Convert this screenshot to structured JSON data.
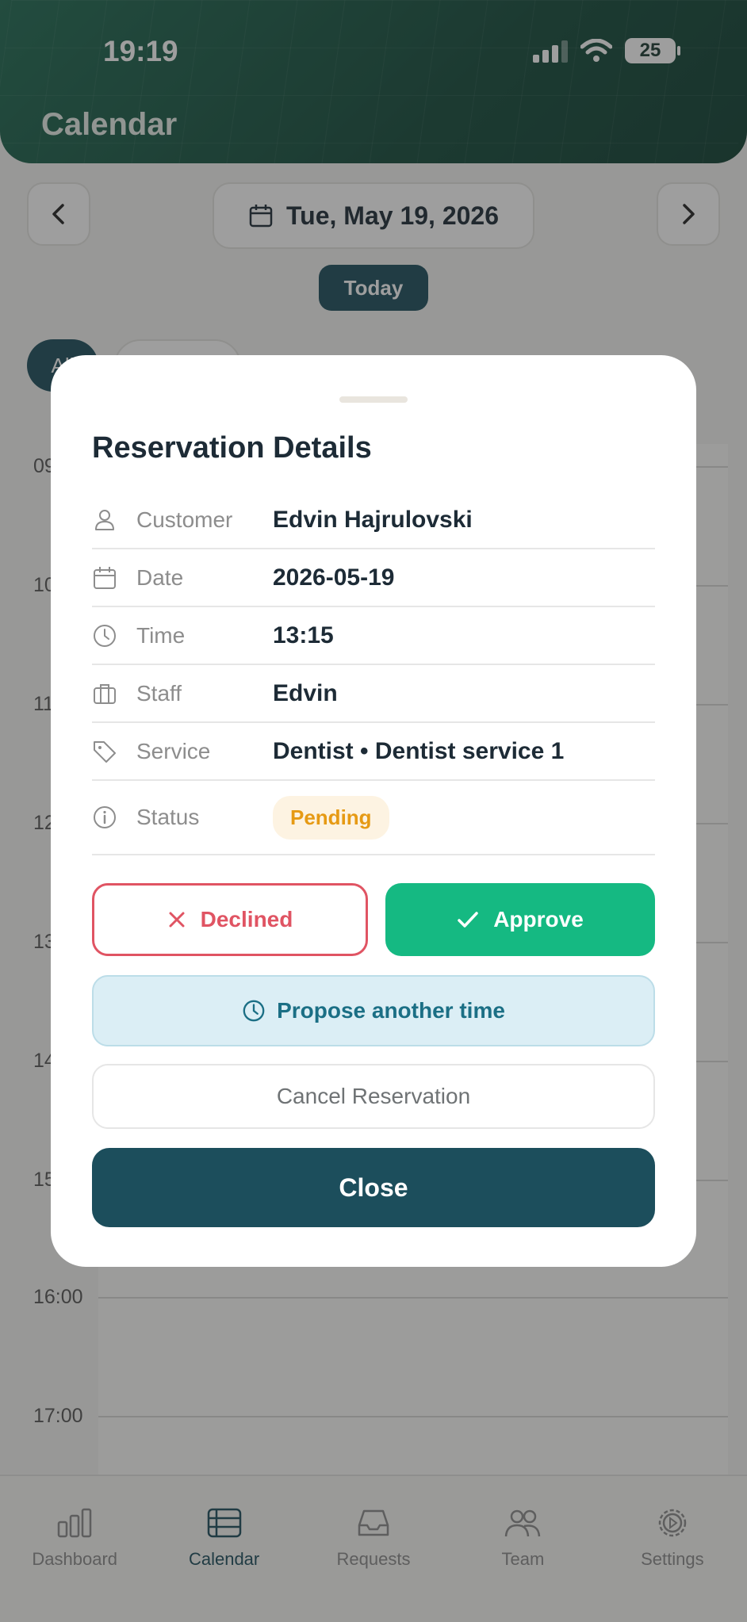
{
  "status_bar": {
    "time": "19:19",
    "battery": "25"
  },
  "header": {
    "title": "Calendar"
  },
  "date_nav": {
    "date": "Tue, May 19, 2026",
    "today_label": "Today",
    "filter_all": "All"
  },
  "timeline": {
    "hours": [
      "09",
      "10",
      "11",
      "12",
      "13",
      "14",
      "15",
      "16:00",
      "17:00"
    ]
  },
  "modal": {
    "title": "Reservation Details",
    "rows": [
      {
        "label": "Customer",
        "value": "Edvin Hajrulovski",
        "icon": "user-icon"
      },
      {
        "label": "Date",
        "value": "2026-05-19",
        "icon": "calendar-icon"
      },
      {
        "label": "Time",
        "value": "13:15",
        "icon": "clock-icon"
      },
      {
        "label": "Staff",
        "value": "Edvin",
        "icon": "briefcase-icon"
      },
      {
        "label": "Service",
        "value": "Dentist • Dentist service 1",
        "icon": "tag-icon"
      }
    ],
    "status": {
      "label": "Status",
      "value": "Pending",
      "color": "#e69a14"
    },
    "decline_label": "Declined",
    "approve_label": "Approve",
    "propose_label": "Propose another time",
    "cancel_label": "Cancel Reservation",
    "close_label": "Close"
  },
  "bottom_nav": {
    "tabs": [
      {
        "label": "Dashboard"
      },
      {
        "label": "Calendar"
      },
      {
        "label": "Requests"
      },
      {
        "label": "Team"
      },
      {
        "label": "Settings"
      }
    ]
  },
  "colors": {
    "primary": "#1c4e5c",
    "approve": "#15b982",
    "decline": "#e05463",
    "pending": "#e69a14"
  }
}
